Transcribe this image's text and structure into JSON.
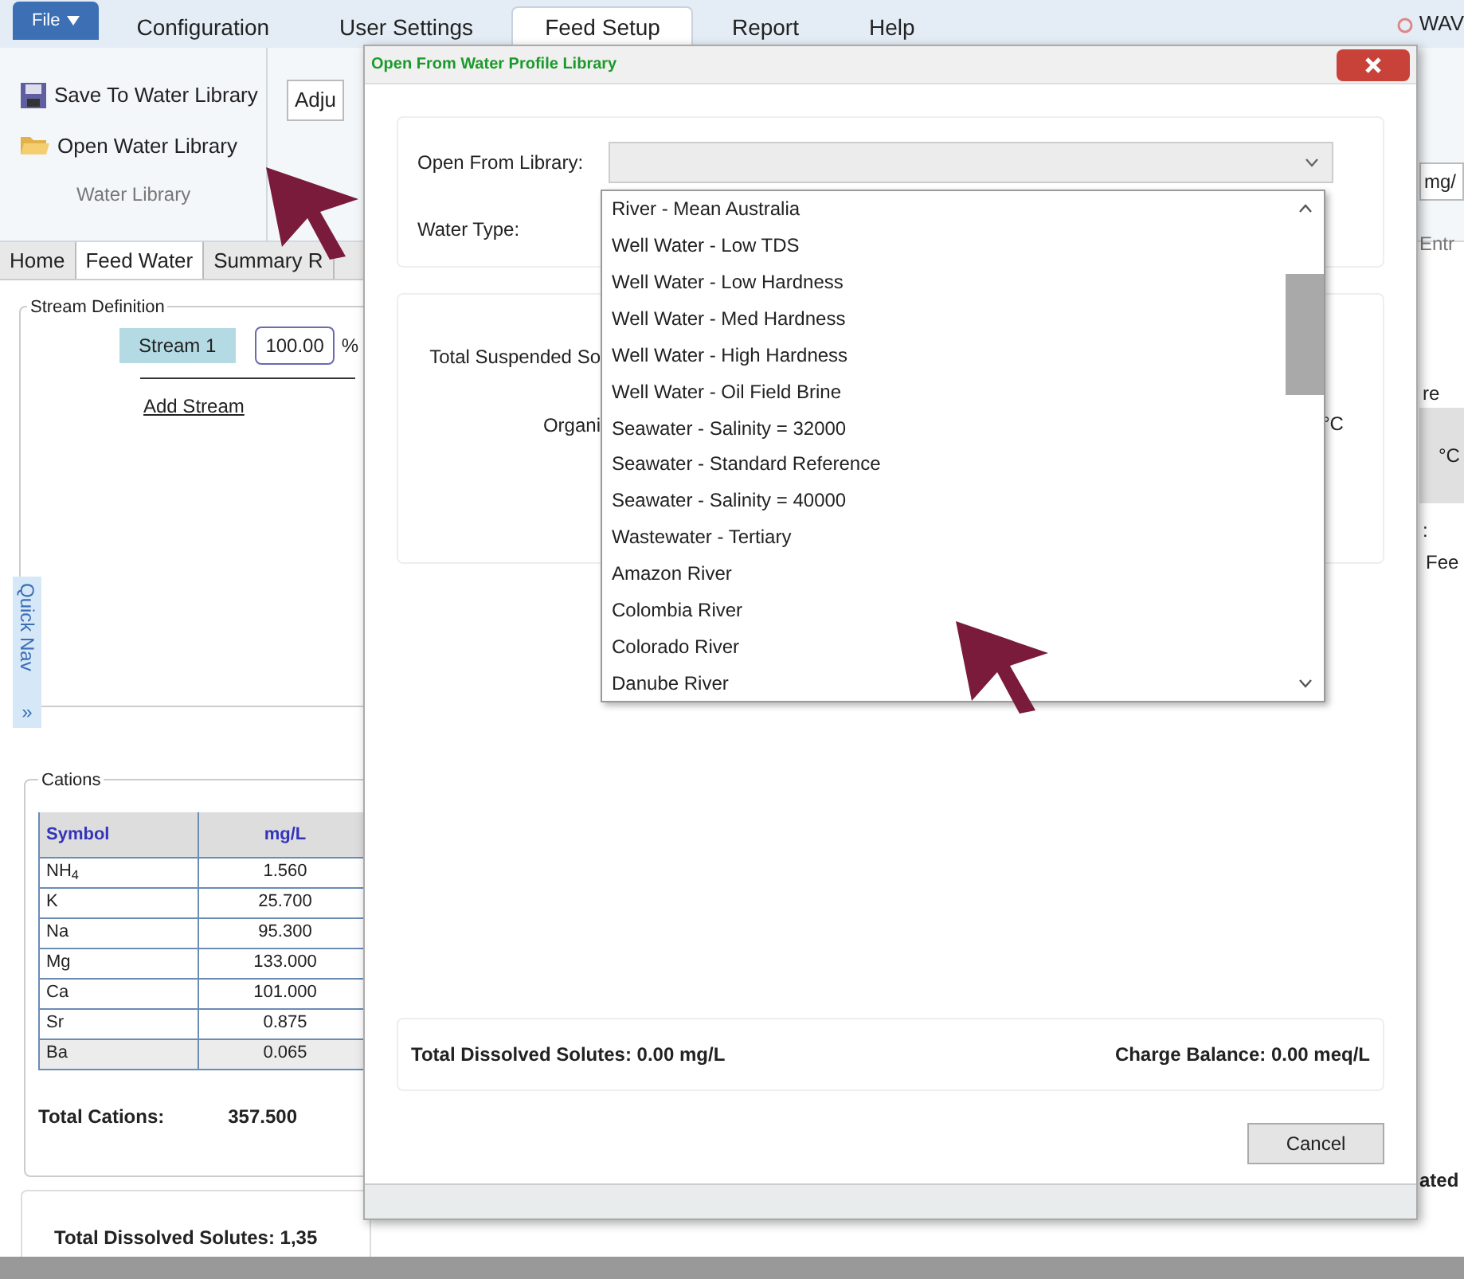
{
  "menu_bar": {
    "file_menu": "File",
    "tabs": [
      {
        "label": "Configuration",
        "selected": false
      },
      {
        "label": "User Settings",
        "selected": false
      },
      {
        "label": "Feed Setup",
        "selected": true
      },
      {
        "label": "Report",
        "selected": false
      },
      {
        "label": "Help",
        "selected": false
      }
    ],
    "app_title": "WAV"
  },
  "ribbon": {
    "buttons": [
      {
        "label": "Save To Water Library",
        "kind": "save"
      },
      {
        "label": "Open Water Library",
        "kind": "open"
      }
    ],
    "group_label": "Water Library",
    "partial_button": "Adju"
  },
  "page_tabs": [
    {
      "label": "Home",
      "selected": false
    },
    {
      "label": "Feed Water",
      "selected": true
    },
    {
      "label": "Summary R",
      "selected": false
    }
  ],
  "stream_definition": {
    "title": "Stream Definition",
    "stream": "Stream 1",
    "percent": "100.00",
    "unit": "%",
    "add_link": "Add Stream"
  },
  "quick_nav": {
    "label": "Quick Nav",
    "icon": "»"
  },
  "cations": {
    "title": "Cations",
    "columns": [
      "Symbol",
      "mg/L"
    ],
    "rows": [
      [
        "NH$_{4}$",
        "1.560"
      ],
      [
        "K",
        "25.700"
      ],
      [
        "Na",
        "95.300"
      ],
      [
        "Mg",
        "133.000"
      ],
      [
        "Ca",
        "101.000"
      ],
      [
        "Sr",
        "0.875"
      ],
      [
        "Ba",
        "0.065"
      ]
    ],
    "total_label": "Total Cations:",
    "total_value": "357.500"
  },
  "tds_footer": "Total Dissolved Solutes: 1,35",
  "right_edge": {
    "unit": "mg/",
    "entry": "Entr",
    "label": "re",
    "temp_unit": "°C",
    "colon": ":",
    "feed": "Fee",
    "status": "ated"
  },
  "dialog": {
    "title": "Open From Water Profile Library",
    "library_label": "Open From Library:",
    "water_type_label": "Water Type:",
    "library_options": [
      "River - Mean Australia",
      "Well Water - Low TDS",
      "Well Water - Low Hardness",
      "Well Water - Med Hardness",
      "Well Water - High Hardness",
      "Well Water - Oil Field Brine",
      "Seawater - Salinity = 32000",
      "Seawater - Standard Reference",
      "Seawater - Salinity = 40000",
      "Wastewater - Tertiary",
      "Amazon River",
      "Colombia River",
      "Colorado River",
      "Danube River"
    ],
    "tss_label": "Total Suspended So",
    "organic_label": "Organi",
    "temp_unit": "°C",
    "tds": "Total Dissolved Solutes: 0.00 mg/L",
    "charge": "Charge Balance: 0.00 meq/L",
    "cancel": "Cancel"
  }
}
